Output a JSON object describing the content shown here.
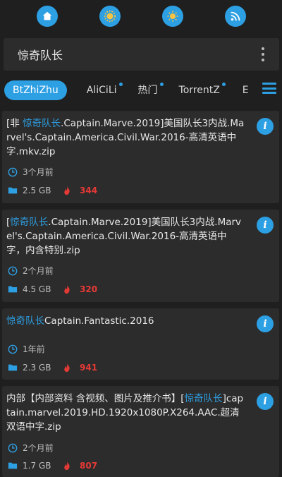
{
  "top_icons": [
    {
      "name": "home-icon"
    },
    {
      "name": "sun-gear-icon"
    },
    {
      "name": "sun-icon"
    },
    {
      "name": "rss-icon"
    }
  ],
  "search": {
    "query": "惊奇队长"
  },
  "tabs": [
    {
      "label": "BtZhiZhu",
      "active": true,
      "dot": false
    },
    {
      "label": "AliCiLi",
      "active": false,
      "dot": true
    },
    {
      "label": "热门",
      "active": false,
      "dot": true
    },
    {
      "label": "TorrentZ",
      "active": false,
      "dot": true
    },
    {
      "label": "E",
      "active": false,
      "dot": false
    }
  ],
  "colors": {
    "accent": "#2d9fe3",
    "hot": "#e53935",
    "card": "#2c2c2c",
    "bg": "#1f1f1f"
  },
  "results": [
    {
      "pre": "[非 ",
      "highlight": "惊奇队长",
      "post": ".Captain.Marve.2019]美国队长3内战.Marvel's.Captain.America.Civil.War.2016-高清英语中字.mkv.zip",
      "time": "3个月前",
      "size": "2.5 GB",
      "hot": "344"
    },
    {
      "pre": "[",
      "highlight": "惊奇队长",
      "post": ".Captain.Marve.2019]美国队长3内战.Marvel's.Captain.America.Civil.War.2016-高清英语中字，内含特别.zip",
      "time": "2个月前",
      "size": "4.5 GB",
      "hot": "320"
    },
    {
      "pre": "",
      "highlight": "惊奇队长",
      "post": "Captain.Fantastic.2016",
      "time": "1年前",
      "size": "2.3 GB",
      "hot": "941"
    },
    {
      "pre": "内部【内部资料 含视频、图片及推介书】[",
      "highlight": "惊奇队长",
      "post": "]captain.marvel.2019.HD.1920x1080P.X264.AAC.超清双语中字.zip",
      "time": "2个月前",
      "size": "1.7 GB",
      "hot": "807"
    }
  ]
}
